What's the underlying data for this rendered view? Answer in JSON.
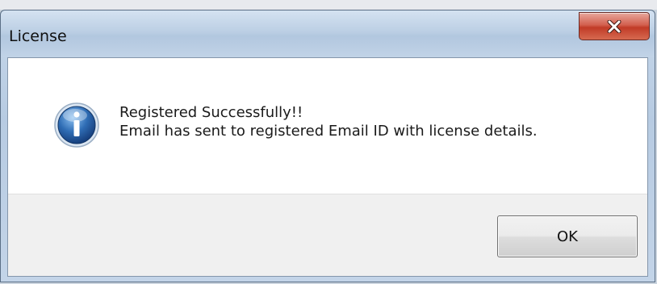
{
  "dialog": {
    "title": "License",
    "close_icon": "close-icon",
    "message_icon": "info-icon",
    "message_lines": [
      "Registered Successfully!!",
      "Email has sent to registered Email ID with license details."
    ],
    "ok_label": "OK"
  },
  "colors": {
    "titlebar": "#bccfe4",
    "close_button": "#c13b27",
    "info_icon": "#2f6db5",
    "button_area": "#f0f0f0"
  }
}
